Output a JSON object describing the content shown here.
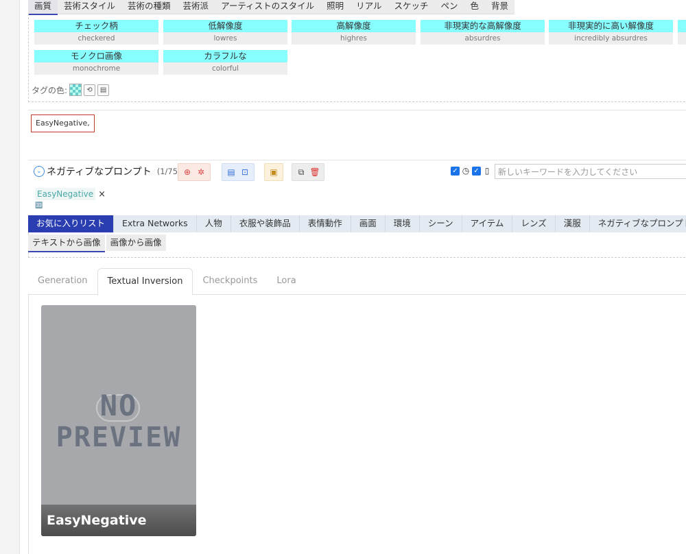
{
  "categories": [
    "画質",
    "芸術スタイル",
    "芸術の種類",
    "芸術派",
    "アーティストのスタイル",
    "照明",
    "リアル",
    "スケッチ",
    "ペン",
    "色",
    "背景"
  ],
  "tags": [
    {
      "jp": "チェック柄",
      "en": "checkered"
    },
    {
      "jp": "低解像度",
      "en": "lowres"
    },
    {
      "jp": "高解像度",
      "en": "highres"
    },
    {
      "jp": "非現実的な高解像度",
      "en": "absurdres"
    },
    {
      "jp": "非現実的に高い解像度",
      "en": "incredibly absurdres"
    },
    {
      "jp": "モノクロ画像",
      "en": "monochrome"
    },
    {
      "jp": "カラフルな",
      "en": "colorful"
    }
  ],
  "tag_color_label": "タグの色:",
  "prompt_text": "EasyNegative,",
  "negative": {
    "title": "ネガティブなプロンプト",
    "count": "(1/75)",
    "keyword_placeholder": "新しいキーワードを入力してください",
    "chip": "EasyNegative",
    "chip_close": "×",
    "tiny_icon": "🈁"
  },
  "fav_tabs": [
    "お気に入りリスト",
    "Extra Networks",
    "人物",
    "衣服や装飾品",
    "表情動作",
    "画面",
    "環境",
    "シーン",
    "アイテム",
    "レンズ",
    "漢服",
    "ネガティブなプロンプト"
  ],
  "sub_tabs": [
    "テキストから画像",
    "画像から画像"
  ],
  "net_tabs": [
    "Generation",
    "Textual Inversion",
    "Checkpoints",
    "Lora"
  ],
  "card": {
    "preview_line1": "NO",
    "preview_line2": "PREVIEW",
    "name": "EasyNegative"
  },
  "colors": {
    "accent": "#2a3eb1",
    "tag_bg": "#88ffff",
    "highlight_border": "#c0392b"
  }
}
